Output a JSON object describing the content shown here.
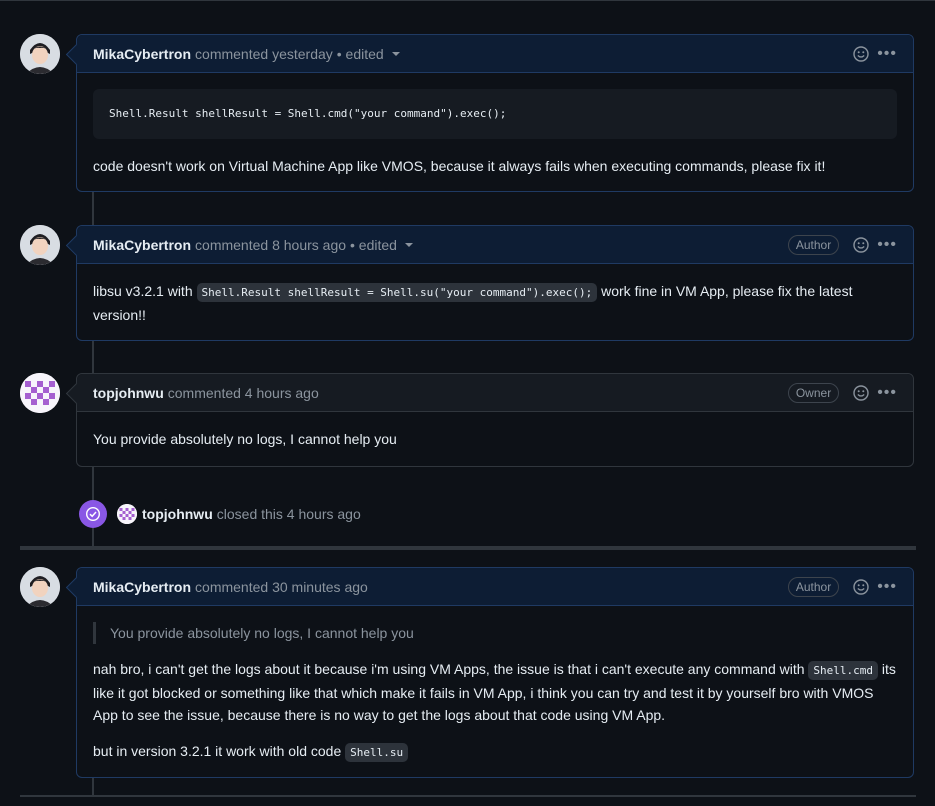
{
  "comments": [
    {
      "author": "MikaCybertron",
      "meta": "commented yesterday",
      "edited": "• edited",
      "code_block": "Shell.Result shellResult = Shell.cmd(\"your command\").exec();",
      "text": "code doesn't work on Virtual Machine App like VMOS, because it always fails when executing commands, please fix it!"
    },
    {
      "author": "MikaCybertron",
      "meta": "commented 8 hours ago",
      "edited": "• edited",
      "badge": "Author",
      "text_before": "libsu v3.2.1 with ",
      "inline_code": "Shell.Result shellResult = Shell.su(\"your command\").exec();",
      "text_after": " work fine in VM App, please fix the latest version!!"
    },
    {
      "author": "topjohnwu",
      "meta": "commented 4 hours ago",
      "badge": "Owner",
      "text": "You provide absolutely no logs, I cannot help you"
    },
    {
      "author": "MikaCybertron",
      "meta": "commented 30 minutes ago",
      "badge": "Author",
      "quote": "You provide absolutely no logs, I cannot help you",
      "p1_before": "nah bro, i can't get the logs about it because i'm using VM Apps, the issue is that i can't execute any command with ",
      "p1_code": "Shell.cmd",
      "p1_after": " its like it got blocked or something like that which make it fails in VM App, i think you can try and test it by yourself bro with VMOS App to see the issue, because there is no way to get the logs about that code using VM App.",
      "p2_before": "but in version 3.2.1 it work with old code ",
      "p2_code": "Shell.su"
    }
  ],
  "event": {
    "author": "topjohnwu",
    "text": "closed this 4 hours ago"
  },
  "icons": {
    "reaction": "smiley-icon",
    "menu": "kebab-horizontal-icon",
    "closed": "check-circle-icon"
  },
  "colors": {
    "closed_badge": "#8957e5",
    "self_border": "#1f3a63",
    "background": "#0d1117"
  }
}
